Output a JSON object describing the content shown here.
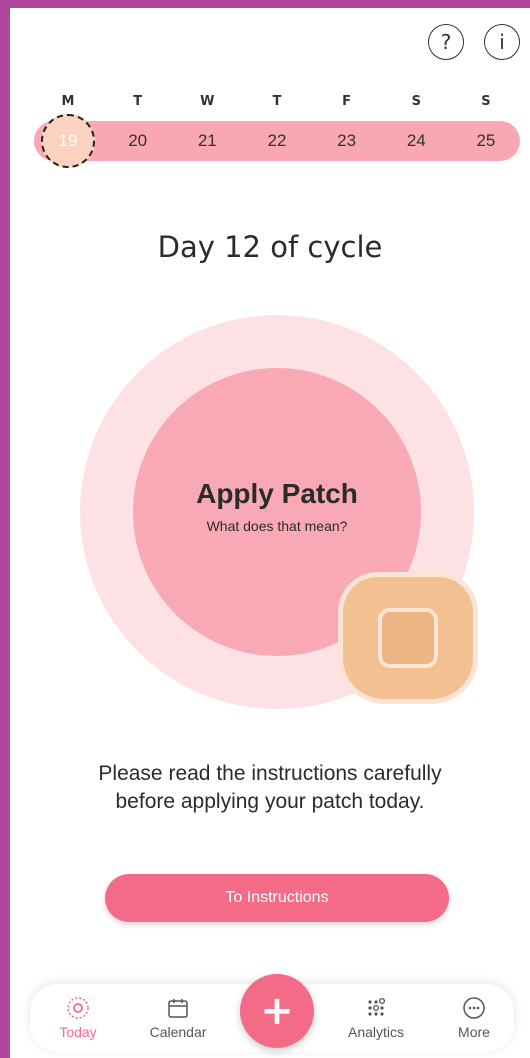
{
  "header": {
    "help_icon": "question-icon",
    "help_glyph": "?",
    "info_icon": "info-icon",
    "info_glyph": "i"
  },
  "week": {
    "days": [
      {
        "label": "M",
        "date": "19",
        "selected": true
      },
      {
        "label": "T",
        "date": "20"
      },
      {
        "label": "W",
        "date": "21"
      },
      {
        "label": "T",
        "date": "22"
      },
      {
        "label": "F",
        "date": "23"
      },
      {
        "label": "S",
        "date": "24"
      },
      {
        "label": "S",
        "date": "25"
      }
    ]
  },
  "cycle": {
    "title": "Day 12 of cycle"
  },
  "status": {
    "title": "Apply Patch",
    "link": "What does that mean?"
  },
  "instructions": {
    "text_line1": "Please read the instructions carefully",
    "text_line2": "before applying your patch today.",
    "button_label": "To Instructions"
  },
  "tabbar": {
    "tabs": [
      {
        "label": "Today",
        "icon": "today-icon",
        "active": true
      },
      {
        "label": "Calendar",
        "icon": "calendar-icon"
      },
      {
        "label": "Analytics",
        "icon": "analytics-icon"
      },
      {
        "label": "More",
        "icon": "more-icon"
      }
    ],
    "fab_glyph": "+"
  },
  "colors": {
    "accent": "#f36b86",
    "date_bar": "#f8a7b3",
    "outer_circle": "#fde1e5",
    "inner_circle": "#f9a9b6",
    "patch": "#f3c092",
    "frame": "#b0479a"
  }
}
